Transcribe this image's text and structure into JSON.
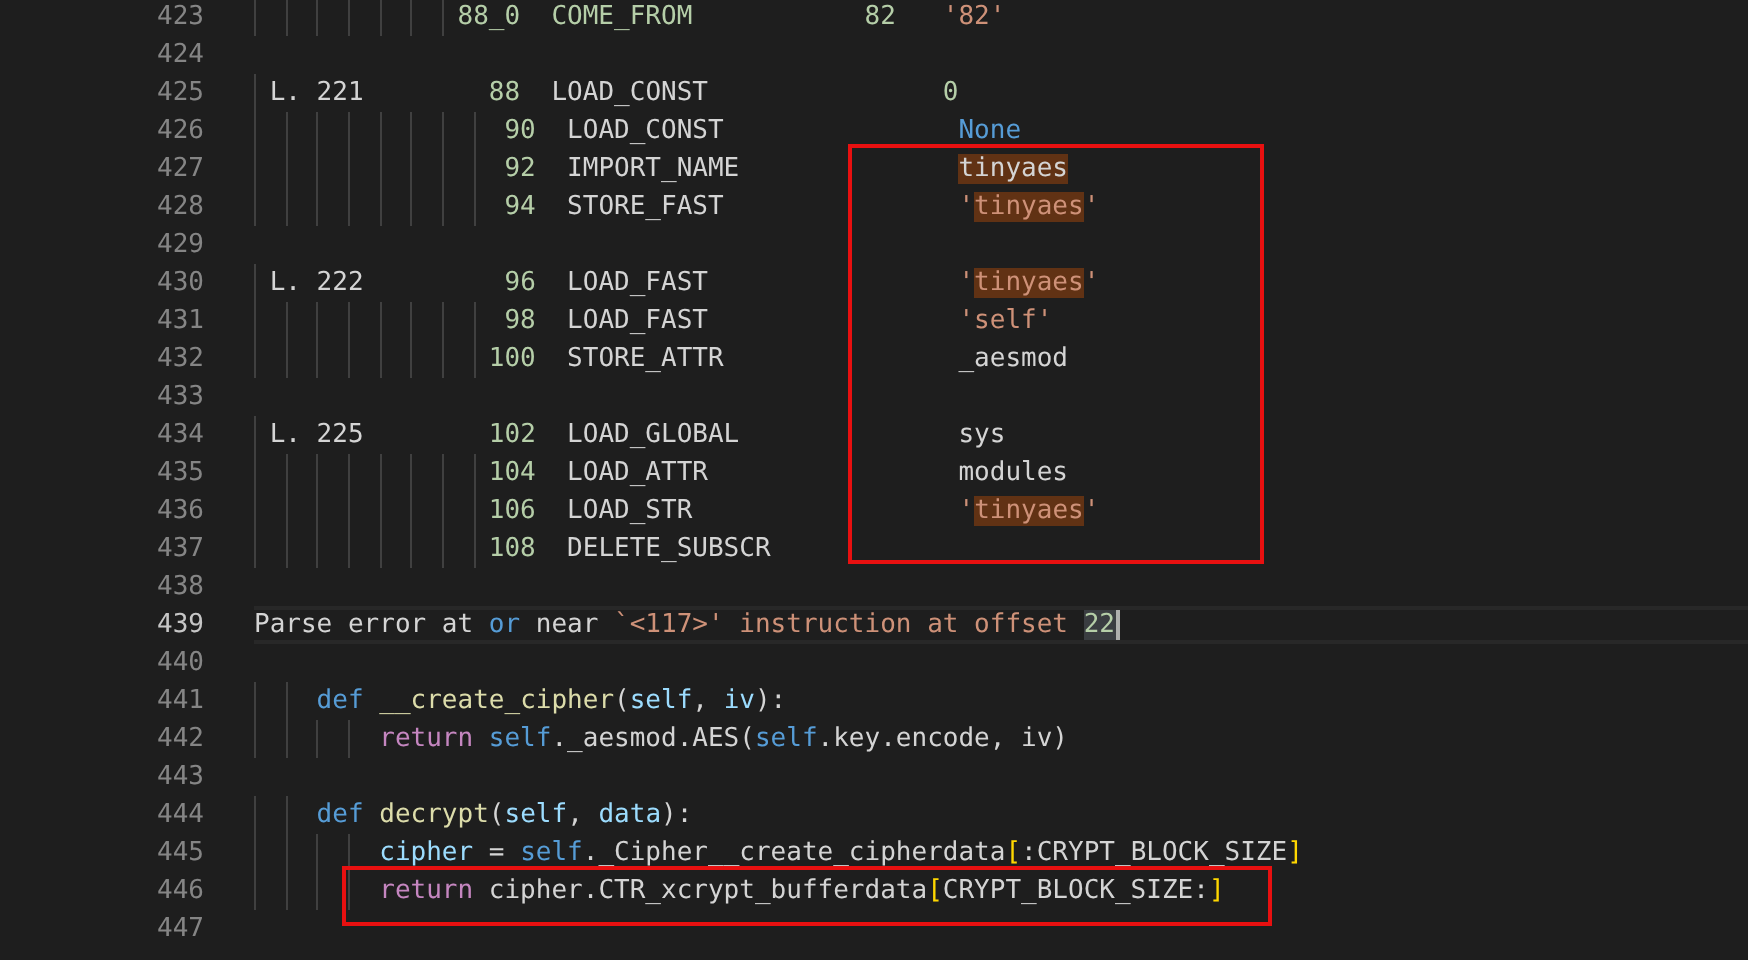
{
  "editor": {
    "lines": [
      {
        "number": "423",
        "current": false,
        "tokens": [
          {
            "text": "             88_0  COME_FROM           82",
            "kind": "num"
          },
          {
            "text": "   '82'",
            "kind": "str"
          }
        ]
      },
      {
        "number": "424",
        "current": false
      },
      {
        "number": "425",
        "current": false,
        "tokens": [
          {
            "text": " L. 221",
            "kind": "plain"
          },
          {
            "text": "        88",
            "kind": "num"
          },
          {
            "text": "  LOAD_CONST",
            "kind": "plain"
          },
          {
            "text": "               0",
            "kind": "num"
          }
        ]
      },
      {
        "number": "426",
        "current": false,
        "tokens": [
          {
            "text": "                90",
            "kind": "num"
          },
          {
            "text": "  LOAD_CONST",
            "kind": "plain"
          },
          {
            "text": "               None",
            "kind": "const"
          }
        ]
      },
      {
        "number": "427",
        "current": false,
        "tokens": [
          {
            "text": "                92",
            "kind": "num"
          },
          {
            "text": "  IMPORT_NAME              ",
            "kind": "plain"
          },
          {
            "text": "tinyaes",
            "kind": "plain",
            "match": true
          }
        ]
      },
      {
        "number": "428",
        "current": false,
        "tokens": [
          {
            "text": "                94",
            "kind": "num"
          },
          {
            "text": "  STORE_FAST",
            "kind": "plain"
          },
          {
            "text": "               '",
            "kind": "str"
          },
          {
            "text": "tinyaes",
            "kind": "str",
            "match": true
          },
          {
            "text": "'",
            "kind": "str"
          }
        ]
      },
      {
        "number": "429",
        "current": false
      },
      {
        "number": "430",
        "current": false,
        "tokens": [
          {
            "text": " L. 222",
            "kind": "plain"
          },
          {
            "text": "         96",
            "kind": "num"
          },
          {
            "text": "  LOAD_FAST",
            "kind": "plain"
          },
          {
            "text": "                '",
            "kind": "str"
          },
          {
            "text": "tinyaes",
            "kind": "str",
            "match": true
          },
          {
            "text": "'",
            "kind": "str"
          }
        ]
      },
      {
        "number": "431",
        "current": false,
        "tokens": [
          {
            "text": "                98",
            "kind": "num"
          },
          {
            "text": "  LOAD_FAST",
            "kind": "plain"
          },
          {
            "text": "                'self'",
            "kind": "str"
          }
        ]
      },
      {
        "number": "432",
        "current": false,
        "tokens": [
          {
            "text": "               100",
            "kind": "num"
          },
          {
            "text": "  STORE_ATTR               _aesmod",
            "kind": "plain"
          }
        ]
      },
      {
        "number": "433",
        "current": false
      },
      {
        "number": "434",
        "current": false,
        "tokens": [
          {
            "text": " L. 225",
            "kind": "plain"
          },
          {
            "text": "        102",
            "kind": "num"
          },
          {
            "text": "  LOAD_GLOBAL              sys",
            "kind": "plain"
          }
        ]
      },
      {
        "number": "435",
        "current": false,
        "tokens": [
          {
            "text": "               104",
            "kind": "num"
          },
          {
            "text": "  LOAD_ATTR                modules",
            "kind": "plain"
          }
        ]
      },
      {
        "number": "436",
        "current": false,
        "tokens": [
          {
            "text": "               106",
            "kind": "num"
          },
          {
            "text": "  LOAD_STR",
            "kind": "plain"
          },
          {
            "text": "                 '",
            "kind": "str"
          },
          {
            "text": "tinyaes",
            "kind": "str",
            "match": true
          },
          {
            "text": "'",
            "kind": "str"
          }
        ]
      },
      {
        "number": "437",
        "current": false,
        "tokens": [
          {
            "text": "               108",
            "kind": "num"
          },
          {
            "text": "  DELETE_SUBSCR",
            "kind": "plain"
          }
        ]
      },
      {
        "number": "438",
        "current": false
      },
      {
        "number": "439",
        "current": true,
        "tokens": [
          {
            "text": "Parse error at ",
            "kind": "plain"
          },
          {
            "text": "or",
            "kind": "kw"
          },
          {
            "text": " near ",
            "kind": "plain"
          },
          {
            "text": "`<117>' instruction at offset ",
            "kind": "str"
          },
          {
            "text": "22",
            "kind": "num",
            "selected": true
          }
        ]
      },
      {
        "number": "440",
        "current": false
      },
      {
        "number": "441",
        "current": false,
        "tokens": [
          {
            "text": "    def",
            "kind": "kw"
          },
          {
            "text": " __create_cipher",
            "kind": "func"
          },
          {
            "text": "(",
            "kind": "plain"
          },
          {
            "text": "self",
            "kind": "var"
          },
          {
            "text": ", ",
            "kind": "plain"
          },
          {
            "text": "iv",
            "kind": "var"
          },
          {
            "text": "):",
            "kind": "plain"
          }
        ]
      },
      {
        "number": "442",
        "current": false,
        "tokens": [
          {
            "text": "        return",
            "kind": "ctrl"
          },
          {
            "text": " self",
            "kind": "kw"
          },
          {
            "text": "._aesmod.AES(",
            "kind": "plain"
          },
          {
            "text": "self",
            "kind": "kw"
          },
          {
            "text": ".key.encode, iv)",
            "kind": "plain"
          }
        ]
      },
      {
        "number": "443",
        "current": false
      },
      {
        "number": "444",
        "current": false,
        "tokens": [
          {
            "text": "    def",
            "kind": "kw"
          },
          {
            "text": " decrypt",
            "kind": "func"
          },
          {
            "text": "(",
            "kind": "plain"
          },
          {
            "text": "self",
            "kind": "var"
          },
          {
            "text": ", ",
            "kind": "plain"
          },
          {
            "text": "data",
            "kind": "var"
          },
          {
            "text": "):",
            "kind": "plain"
          }
        ]
      },
      {
        "number": "445",
        "current": false,
        "tokens": [
          {
            "text": "        cipher",
            "kind": "var"
          },
          {
            "text": " = ",
            "kind": "plain"
          },
          {
            "text": "self",
            "kind": "kw"
          },
          {
            "text": "._Cipher__create_cipherdata",
            "kind": "plain"
          },
          {
            "text": "[",
            "kind": "bracket"
          },
          {
            "text": ":CRYPT_BLOCK_SIZE",
            "kind": "plain"
          },
          {
            "text": "]",
            "kind": "bracket"
          }
        ]
      },
      {
        "number": "446",
        "current": false,
        "tokens": [
          {
            "text": "        return",
            "kind": "ctrl"
          },
          {
            "text": " cipher.CTR_xcrypt_bufferdata",
            "kind": "plain"
          },
          {
            "text": "[",
            "kind": "bracket"
          },
          {
            "text": "CRYPT_BLOCK_SIZE:",
            "kind": "plain"
          },
          {
            "text": "]",
            "kind": "bracket"
          }
        ]
      },
      {
        "number": "447",
        "current": false
      }
    ],
    "annotation_boxes": [
      {
        "kind": "rectangle"
      },
      {
        "kind": "rectangle"
      }
    ]
  }
}
